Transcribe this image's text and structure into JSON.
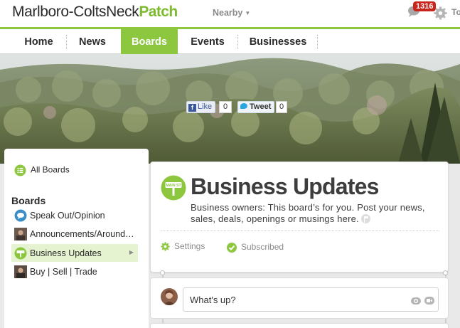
{
  "header": {
    "site_name_main": "Marlboro-ColtsNeck",
    "site_name_brand": "Patch",
    "nearby_label": "Nearby",
    "notification_count": "1316",
    "user_label_partial": "To"
  },
  "nav": {
    "tabs": [
      {
        "label": "Home",
        "active": false
      },
      {
        "label": "News",
        "active": false
      },
      {
        "label": "Boards",
        "active": true
      },
      {
        "label": "Events",
        "active": false
      },
      {
        "label": "Businesses",
        "active": false
      }
    ]
  },
  "sidebar": {
    "all_boards_label": "All Boards",
    "heading": "Boards",
    "items": [
      {
        "label": "Speak Out/Opinion",
        "icon": "speech-icon",
        "active": false
      },
      {
        "label": "Announcements/Around Town",
        "icon": "avatar-thumbnail",
        "active": false
      },
      {
        "label": "Business Updates",
        "icon": "main-street-sign-icon",
        "active": true
      },
      {
        "label": "Buy | Sell | Trade",
        "icon": "avatar-thumbnail",
        "active": false
      }
    ]
  },
  "board": {
    "title": "Business Updates",
    "icon_text": "MAIN ST",
    "description": "Business owners: This board’s for you. Post your news, sales, deals, openings or musings here.",
    "settings_label": "Settings",
    "subscribed_label": "Subscribed",
    "facebook_like_label": "Like",
    "facebook_like_count": "0",
    "tweet_label": "Tweet",
    "tweet_count": "0"
  },
  "composer": {
    "placeholder": "What's up?"
  },
  "colors": {
    "brand_green": "#8dc63f",
    "patch_green": "#7dba2f",
    "badge_red": "#c8241c",
    "active_sidebar_bg": "#e6f3d0",
    "text_dark": "#2b2b2b",
    "text_muted": "#8a8a8a"
  }
}
